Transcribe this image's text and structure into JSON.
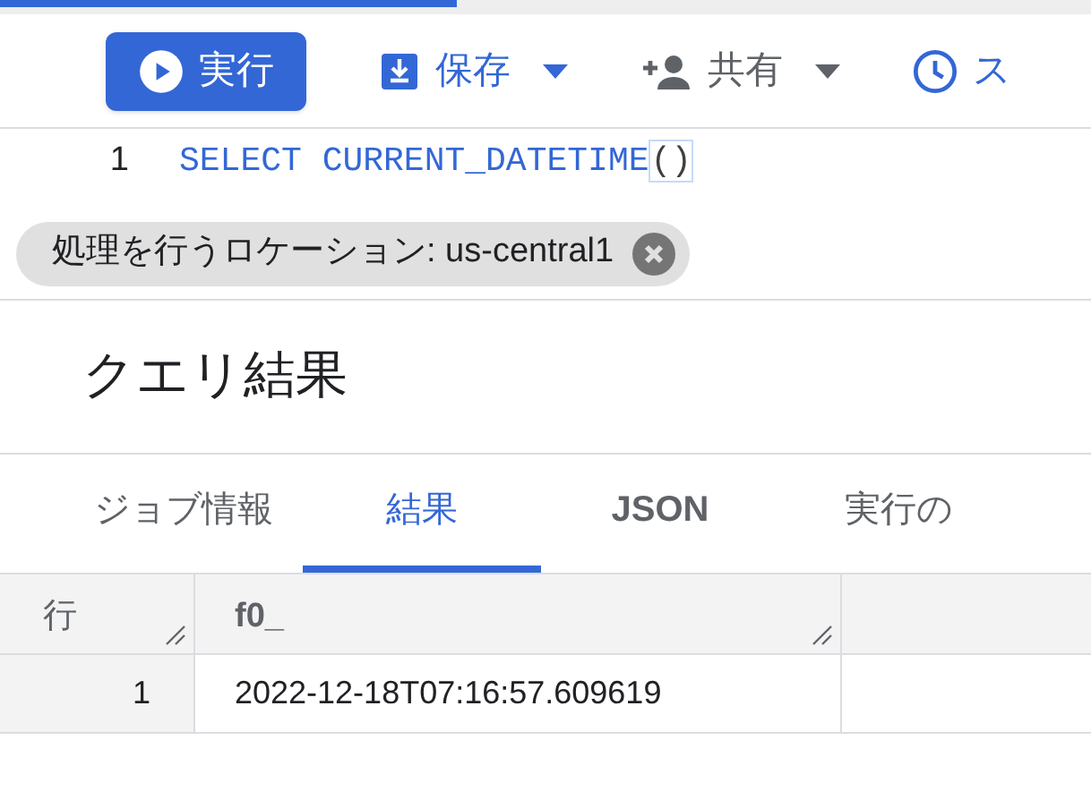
{
  "toolbar": [
    {
      "label": "実行",
      "kind": "primary",
      "menu": false
    },
    {
      "label": "保存",
      "kind": "accent",
      "menu": true
    },
    {
      "label": "共有",
      "kind": "plain",
      "menu": true
    },
    {
      "label": "ス",
      "kind": "accent",
      "menu": false
    }
  ],
  "editor": {
    "lines": [
      {
        "number": "1",
        "keyword": "SELECT CURRENT_DATETIME",
        "rest": "()"
      }
    ]
  },
  "location_chip": {
    "label": "処理を行うロケーション: us-central1"
  },
  "results": {
    "title": "クエリ結果",
    "tabs": [
      {
        "label": "ジョブ情報",
        "selected": false
      },
      {
        "label": "結果",
        "selected": true
      },
      {
        "label": "JSON",
        "selected": false
      },
      {
        "label": "実行の",
        "selected": false
      }
    ],
    "table": {
      "columns": [
        "行",
        "f0_"
      ],
      "rows": [
        {
          "cells": [
            "1",
            "2022-12-18T07:16:57.609619"
          ]
        }
      ]
    }
  }
}
